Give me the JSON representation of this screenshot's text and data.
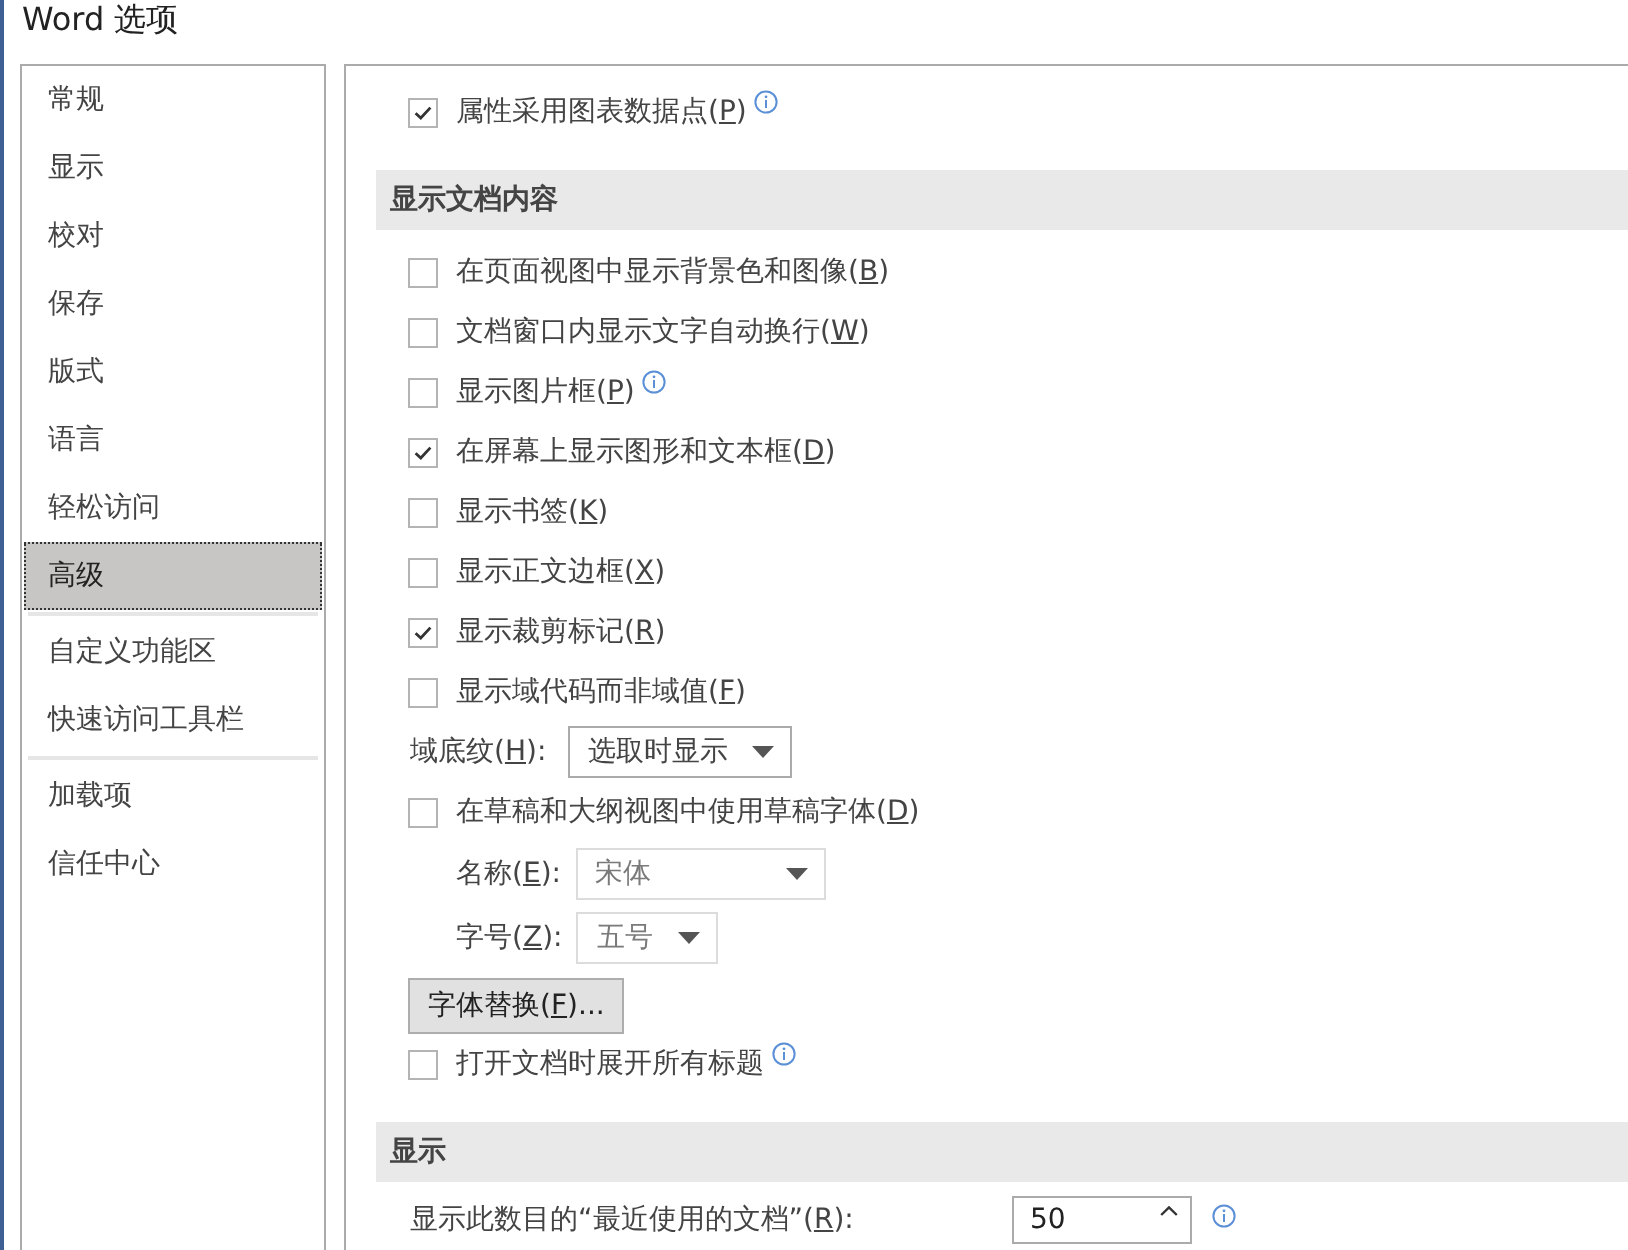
{
  "window": {
    "title": "Word 选项"
  },
  "sidebar": {
    "groups": [
      {
        "items": [
          {
            "label": "常规",
            "selected": false
          },
          {
            "label": "显示",
            "selected": false
          },
          {
            "label": "校对",
            "selected": false
          },
          {
            "label": "保存",
            "selected": false
          },
          {
            "label": "版式",
            "selected": false
          },
          {
            "label": "语言",
            "selected": false
          },
          {
            "label": "轻松访问",
            "selected": false
          },
          {
            "label": "高级",
            "selected": true
          }
        ]
      },
      {
        "items": [
          {
            "label": "自定义功能区",
            "selected": false
          },
          {
            "label": "快速访问工具栏",
            "selected": false
          }
        ]
      },
      {
        "items": [
          {
            "label": "加载项",
            "selected": false
          },
          {
            "label": "信任中心",
            "selected": false
          }
        ]
      }
    ]
  },
  "content": {
    "rows": [
      {
        "kind": "checkbox",
        "label": "属性采用图表数据点(",
        "accesskey": "P",
        "label_end": ")",
        "checked": true,
        "info": true
      },
      {
        "kind": "section",
        "title": "显示文档内容"
      },
      {
        "kind": "checkbox",
        "label": "在页面视图中显示背景色和图像(",
        "accesskey": "B",
        "label_end": ")",
        "checked": false,
        "info": false
      },
      {
        "kind": "checkbox",
        "label": "文档窗口内显示文字自动换行(",
        "accesskey": "W",
        "label_end": ")",
        "checked": false,
        "info": false
      },
      {
        "kind": "checkbox",
        "label": "显示图片框(",
        "accesskey": "P",
        "label_end": ")",
        "checked": false,
        "info": true
      },
      {
        "kind": "checkbox",
        "label": "在屏幕上显示图形和文本框(",
        "accesskey": "D",
        "label_end": ")",
        "checked": true,
        "info": false
      },
      {
        "kind": "checkbox",
        "label": "显示书签(",
        "accesskey": "K",
        "label_end": ")",
        "checked": false,
        "info": false
      },
      {
        "kind": "checkbox",
        "label": "显示正文边框(",
        "accesskey": "X",
        "label_end": ")",
        "checked": false,
        "info": false
      },
      {
        "kind": "checkbox",
        "label": "显示裁剪标记(",
        "accesskey": "R",
        "label_end": ")",
        "checked": true,
        "info": false
      },
      {
        "kind": "checkbox",
        "label": "显示域代码而非域值(",
        "accesskey": "F",
        "label_end": ")",
        "checked": false,
        "info": false
      },
      {
        "kind": "dropdown",
        "label": "域底纹(",
        "accesskey": "H",
        "label_end": "):",
        "value": "选取时显示",
        "disabled": false
      },
      {
        "kind": "checkbox",
        "label": "在草稿和大纲视图中使用草稿字体(",
        "accesskey": "D",
        "label_end": ")",
        "checked": false,
        "info": false,
        "children": [
          {
            "kind": "dropdown",
            "label": "名称(",
            "accesskey": "E",
            "label_end": "):",
            "value": "宋体",
            "disabled": true
          },
          {
            "kind": "dropdown",
            "label": "字号(",
            "accesskey": "Z",
            "label_end": "):",
            "value": "五号",
            "disabled": true
          }
        ]
      },
      {
        "kind": "button",
        "label": "字体替换(",
        "accesskey": "F",
        "label_end": ")..."
      },
      {
        "kind": "checkbox",
        "label": "打开文档时展开所有标题",
        "checked": false,
        "info": true
      },
      {
        "kind": "section",
        "title": "显示"
      },
      {
        "kind": "number",
        "label": "显示此数目的“最近使用的文档”(",
        "accesskey": "R",
        "label_end": "):",
        "value": "50",
        "info": true
      }
    ]
  }
}
